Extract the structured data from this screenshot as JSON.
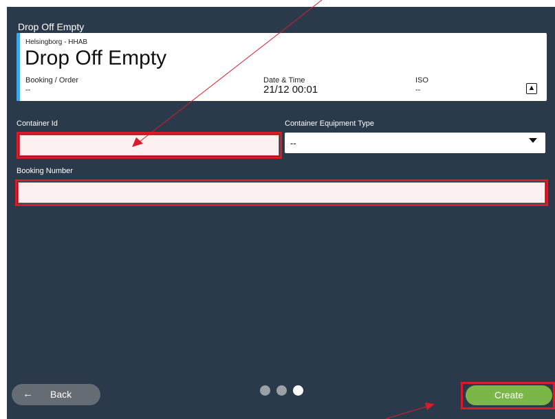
{
  "window": {
    "title": "Drop Off Empty"
  },
  "card": {
    "location": "Helsingborg - HHAB",
    "title": "Drop Off Empty",
    "booking_label": "Booking / Order",
    "booking_value": "--",
    "datetime_label": "Date & Time",
    "datetime_value": "21/12 00:01",
    "iso_label": "ISO",
    "iso_value": "--",
    "icon": "expand-icon"
  },
  "form": {
    "container_id_label": "Container Id",
    "container_id_value": "",
    "equipment_type_label": "Container Equipment Type",
    "equipment_type_value": "--",
    "booking_number_label": "Booking Number",
    "booking_number_value": ""
  },
  "footer": {
    "back_label": "Back",
    "create_label": "Create",
    "page_count": 3,
    "current_page": 3
  },
  "colors": {
    "background": "#2b3a4a",
    "accent": "#3fa7e3",
    "create": "#7ab648",
    "highlight": "#d81c2c"
  }
}
